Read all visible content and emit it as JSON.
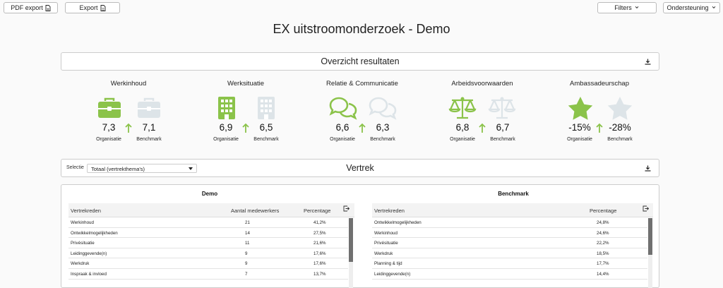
{
  "toolbar": {
    "pdf_export": "PDF export",
    "export": "Export",
    "filters": "Filters",
    "support": "Ondersteuning"
  },
  "page_title": "EX uitstroomonderzoek - Demo",
  "overview": {
    "title": "Overzicht resultaten",
    "metrics": [
      {
        "title": "Werkinhoud",
        "icon": "briefcase-icon",
        "org_value": "7,3",
        "bench_value": "7,1",
        "org_label": "Organisatie",
        "bench_label": "Benchmark"
      },
      {
        "title": "Werksituatie",
        "icon": "building-icon",
        "org_value": "6,9",
        "bench_value": "6,5",
        "org_label": "Organisatie",
        "bench_label": "Benchmark"
      },
      {
        "title": "Relatie & Communicatie",
        "icon": "chat-bubbles-icon",
        "org_value": "6,6",
        "bench_value": "6,3",
        "org_label": "Organisatie",
        "bench_label": "Benchmark"
      },
      {
        "title": "Arbeidsvoorwaarden",
        "icon": "scale-icon",
        "org_value": "6,8",
        "bench_value": "6,7",
        "org_label": "Organisatie",
        "bench_label": "Benchmark"
      },
      {
        "title": "Ambassadeurschap",
        "icon": "star-icon",
        "org_value": "-15%",
        "bench_value": "-28%",
        "org_label": "Organisatie",
        "bench_label": "Benchmark"
      }
    ],
    "colors": {
      "accent": "#8bc34a",
      "muted": "#dde4e8"
    }
  },
  "vertrek": {
    "title": "Vertrek",
    "selectie_label": "Selectie",
    "selectie_value": "Totaal (vertrekthema's)"
  },
  "demo_table": {
    "title": "Demo",
    "headers": [
      "Vertrekreden",
      "Aantal medewerkers",
      "Percentage"
    ],
    "rows": [
      {
        "reden": "Werkinhoud",
        "aantal": "21",
        "pct": "41,2%"
      },
      {
        "reden": "Ontwikkelmogelijkheden",
        "aantal": "14",
        "pct": "27,5%"
      },
      {
        "reden": "Privésituatie",
        "aantal": "11",
        "pct": "21,6%"
      },
      {
        "reden": "Leidinggevende(n)",
        "aantal": "9",
        "pct": "17,6%"
      },
      {
        "reden": "Werkdruk",
        "aantal": "9",
        "pct": "17,6%"
      },
      {
        "reden": "Inspraak & invloed",
        "aantal": "7",
        "pct": "13,7%"
      }
    ]
  },
  "benchmark_table": {
    "title": "Benchmark",
    "headers": [
      "Vertrekreden",
      "Percentage"
    ],
    "rows": [
      {
        "reden": "Ontwikkelmogelijkheden",
        "pct": "24,8%"
      },
      {
        "reden": "Werkinhoud",
        "pct": "24,6%"
      },
      {
        "reden": "Privésituatie",
        "pct": "22,2%"
      },
      {
        "reden": "Werkdruk",
        "pct": "18,5%"
      },
      {
        "reden": "Planning & tijd",
        "pct": "17,7%"
      },
      {
        "reden": "Leidinggevende(n)",
        "pct": "14,4%"
      }
    ]
  }
}
